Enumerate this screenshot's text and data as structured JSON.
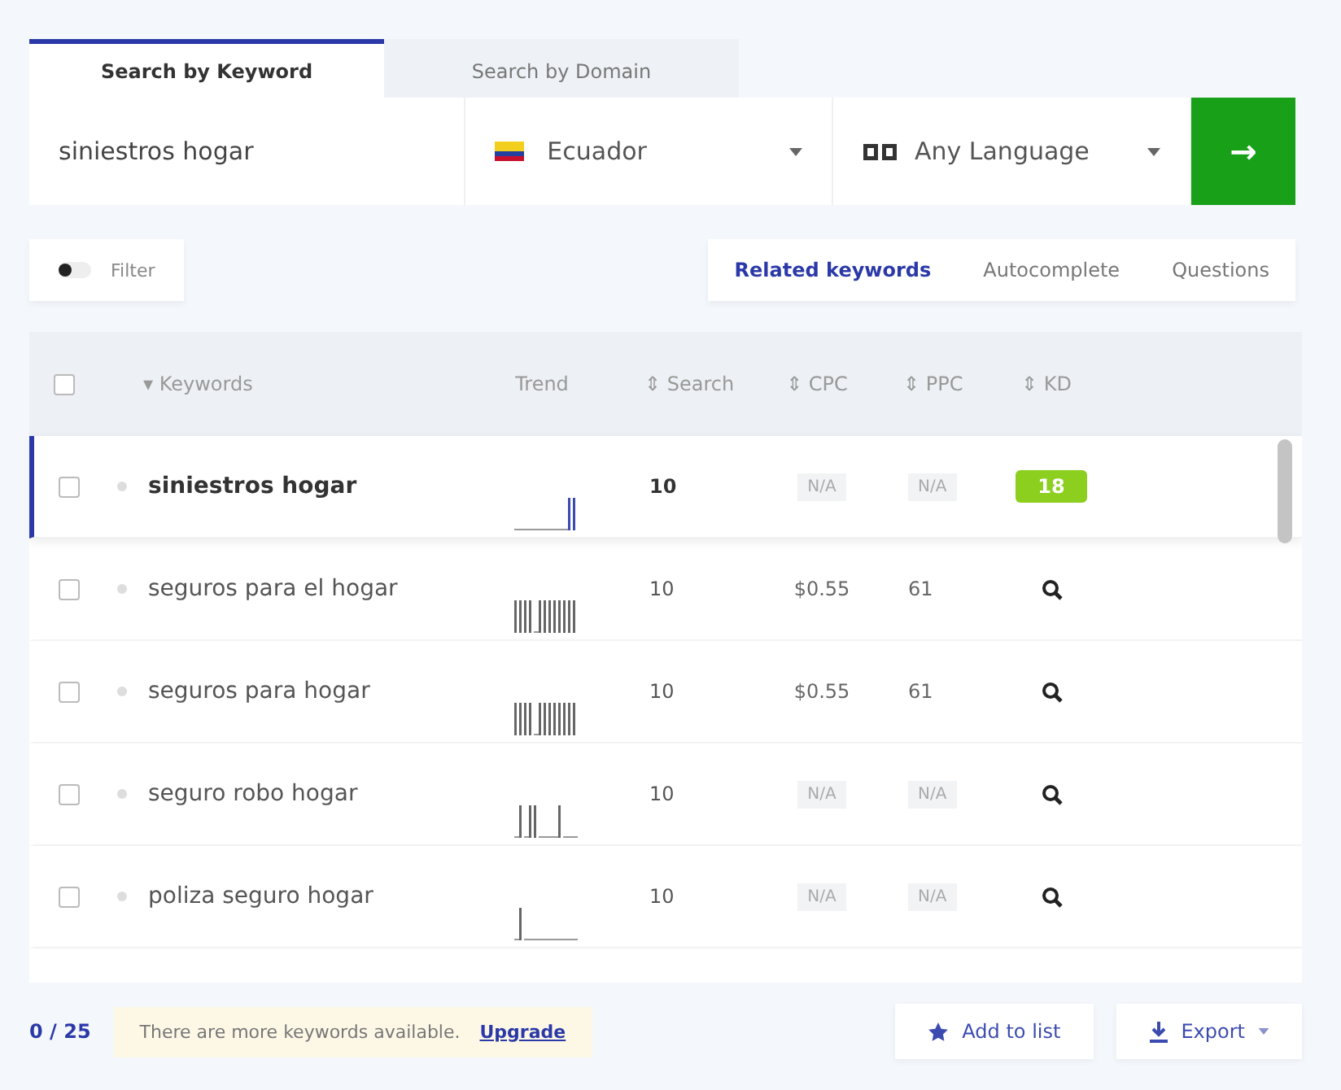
{
  "search_tabs": [
    {
      "label": "Search by Keyword",
      "selected": true
    },
    {
      "label": "Search by Domain",
      "selected": false
    }
  ],
  "search": {
    "value": "siniestros hogar",
    "country": "Ecuador",
    "language": "Any Language",
    "submit": "→"
  },
  "filter": {
    "label": "Filter",
    "on": false
  },
  "result_tabs": [
    {
      "label": "Related keywords",
      "selected": true
    },
    {
      "label": "Autocomplete",
      "selected": false
    },
    {
      "label": "Questions",
      "selected": false
    }
  ],
  "table": {
    "select_all_checked": false,
    "columns": [
      "▾ Keywords",
      "Trend",
      "⇕ Search",
      "⇕ CPC",
      "⇕ PPC",
      "⇕ KD"
    ],
    "rows": [
      {
        "keyword": "siniestros hogar",
        "selected": true,
        "checked": false,
        "search": "10",
        "cpc": {
          "text": "N/A",
          "muted": true
        },
        "ppc": {
          "text": "N/A",
          "muted": true
        },
        "kd": {
          "kind": "badge",
          "text": "18",
          "color": "#8ccf1f"
        }
      },
      {
        "keyword": "seguros para el hogar",
        "selected": false,
        "checked": false,
        "search": "10",
        "cpc": {
          "text": "$0.55",
          "muted": false
        },
        "ppc": {
          "text": "61",
          "muted": false
        },
        "kd": {
          "kind": "lookup"
        }
      },
      {
        "keyword": "seguros para hogar",
        "selected": false,
        "checked": false,
        "search": "10",
        "cpc": {
          "text": "$0.55",
          "muted": false
        },
        "ppc": {
          "text": "61",
          "muted": false
        },
        "kd": {
          "kind": "lookup"
        }
      },
      {
        "keyword": "seguro robo hogar",
        "selected": false,
        "checked": false,
        "search": "10",
        "cpc": {
          "text": "N/A",
          "muted": true
        },
        "ppc": {
          "text": "N/A",
          "muted": true
        },
        "kd": {
          "kind": "lookup"
        }
      },
      {
        "keyword": "poliza seguro hogar",
        "selected": false,
        "checked": false,
        "search": "10",
        "cpc": {
          "text": "N/A",
          "muted": true
        },
        "ppc": {
          "text": "N/A",
          "muted": true
        },
        "kd": {
          "kind": "lookup"
        }
      }
    ]
  },
  "footer": {
    "count": "0 / 25",
    "notice": "There are more keywords available.",
    "upgrade": "Upgrade",
    "add_to_list": "Add to list",
    "export": "Export"
  }
}
